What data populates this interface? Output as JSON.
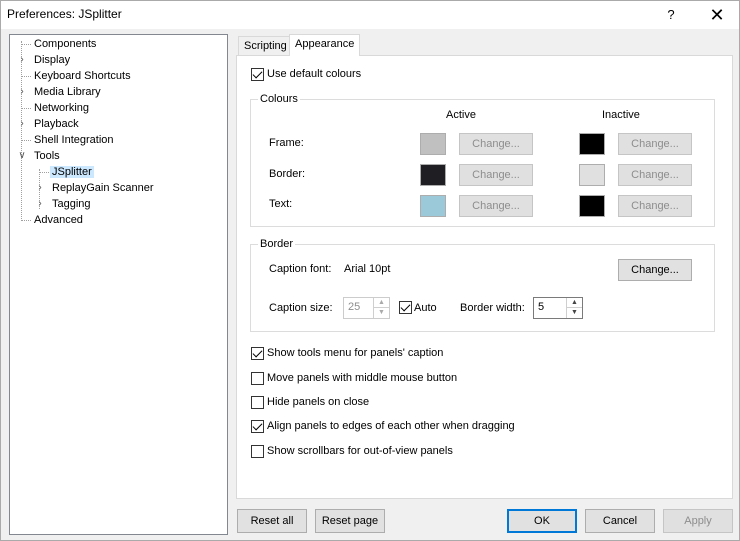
{
  "window": {
    "title": "Preferences: JSplitter",
    "help": "?",
    "close": "✕"
  },
  "tree": [
    {
      "label": "Components",
      "selected": false
    },
    {
      "label": "Display",
      "selected": false
    },
    {
      "label": "Keyboard Shortcuts",
      "selected": false
    },
    {
      "label": "Media Library",
      "selected": false
    },
    {
      "label": "Networking",
      "selected": false
    },
    {
      "label": "Playback",
      "selected": false
    },
    {
      "label": "Shell Integration",
      "selected": false
    },
    {
      "label": "Tools",
      "selected": false
    },
    {
      "label": "JSplitter",
      "selected": true
    },
    {
      "label": "ReplayGain Scanner",
      "selected": false
    },
    {
      "label": "Tagging",
      "selected": false
    },
    {
      "label": "Advanced",
      "selected": false
    }
  ],
  "tabs": [
    {
      "label": "Scripting"
    },
    {
      "label": "Appearance"
    }
  ],
  "appearance": {
    "use_default_colours": "Use default colours",
    "colours": {
      "title": "Colours",
      "active_header": "Active",
      "inactive_header": "Inactive",
      "rows": [
        {
          "label": "Frame:",
          "active_color": "#c0c0c0",
          "inactive_color": "#000000",
          "change": "Change..."
        },
        {
          "label": "Border:",
          "active_color": "#1e1e23",
          "inactive_color": "#e0e0e0",
          "change": "Change..."
        },
        {
          "label": "Text:",
          "active_color": "#9cc9da",
          "inactive_color": "#000000",
          "change": "Change..."
        }
      ]
    },
    "border": {
      "title": "Border",
      "caption_font_label": "Caption font:",
      "caption_font_value": "Arial 10pt",
      "change": "Change...",
      "caption_size_label": "Caption size:",
      "caption_size_value": "25",
      "auto_label": "Auto",
      "border_width_label": "Border width:",
      "border_width_value": "5"
    },
    "options": [
      {
        "label": "Show tools menu for panels' caption",
        "checked": true
      },
      {
        "label": "Move panels with middle mouse button",
        "checked": false
      },
      {
        "label": "Hide panels on close",
        "checked": false
      },
      {
        "label": "Align panels to edges of each other when dragging",
        "checked": true
      },
      {
        "label": "Show scrollbars for out-of-view panels",
        "checked": false
      }
    ]
  },
  "footer": {
    "reset_all": "Reset all",
    "reset_page": "Reset page",
    "ok": "OK",
    "cancel": "Cancel",
    "apply": "Apply"
  }
}
